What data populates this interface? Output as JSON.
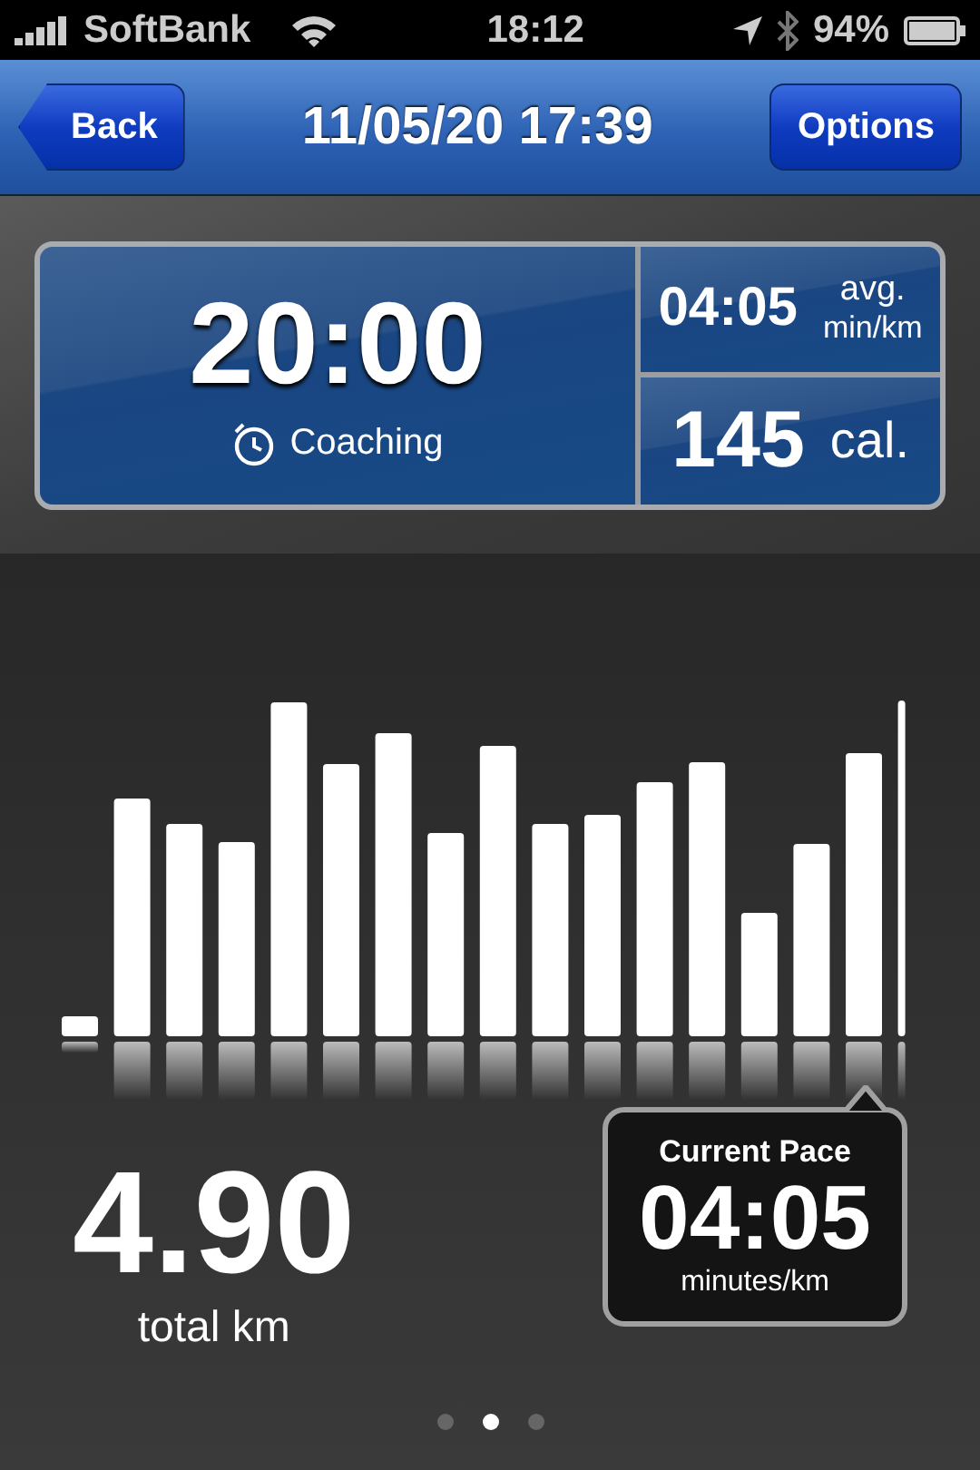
{
  "status_bar": {
    "carrier": "SoftBank",
    "time": "18:12",
    "battery": "94%"
  },
  "nav": {
    "back": "Back",
    "title": "11/05/20 17:39",
    "options": "Options"
  },
  "summary": {
    "duration": "20:00",
    "mode": "Coaching",
    "pace": "04:05",
    "pace_unit_1": "avg.",
    "pace_unit_2": "min/km",
    "calories": "145",
    "calories_unit": "cal."
  },
  "distance": {
    "value": "4.90",
    "unit": "total km"
  },
  "current_pace": {
    "label": "Current Pace",
    "value": "04:05",
    "unit": "minutes/km"
  },
  "pages": [
    {
      "selected": false
    },
    {
      "selected": true
    },
    {
      "selected": false
    }
  ]
}
